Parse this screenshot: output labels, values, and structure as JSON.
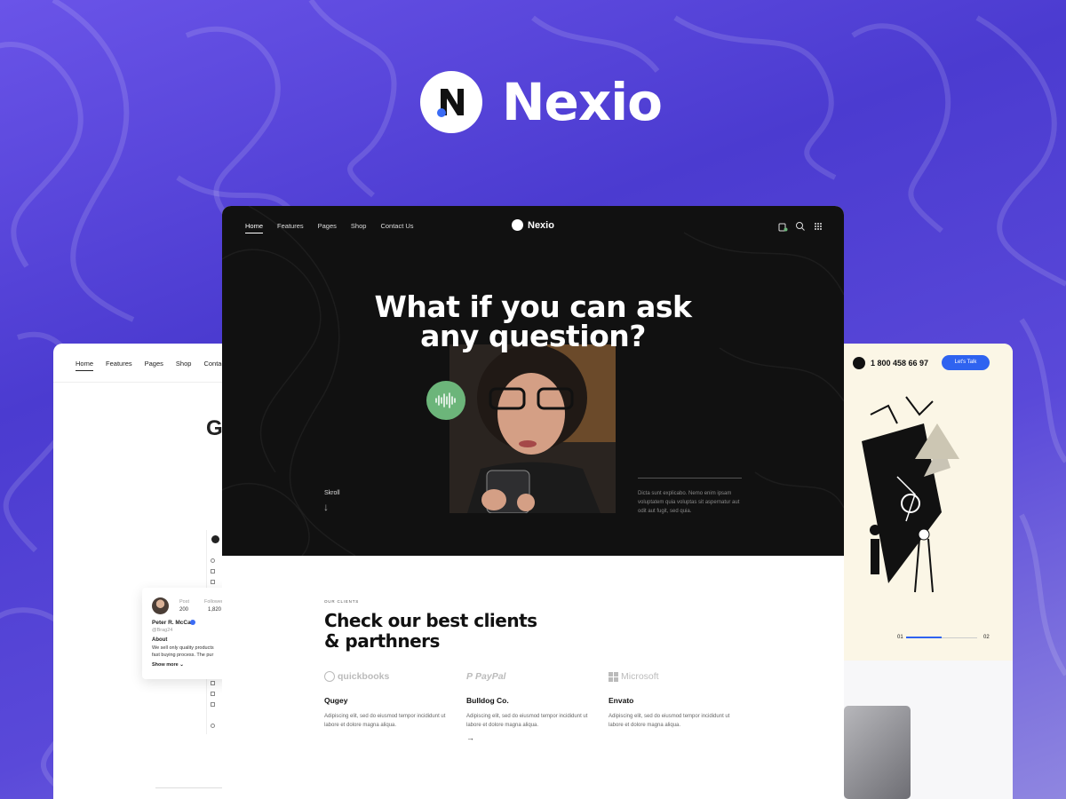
{
  "brand": {
    "name": "Nexio"
  },
  "left_card": {
    "nav": [
      "Home",
      "Features",
      "Pages",
      "Shop",
      "Contac"
    ],
    "heading_fragment": "G",
    "profile": {
      "post_label": "Post",
      "post_value": "200",
      "followers_label": "Follower",
      "followers_value": "1,820",
      "name": "Peter R. McCall",
      "handle": "@Brag24",
      "about_label": "About",
      "about_text_1": "We sell only quality products",
      "about_text_2": "fast buying process. The pur",
      "show_more": "Show more"
    }
  },
  "main": {
    "nav": [
      "Home",
      "Features",
      "Pages",
      "Shop",
      "Contact Us"
    ],
    "brand": "Nexio",
    "hero_title_1": "What if you can ask",
    "hero_title_2": "any question?",
    "scroll_label": "Skroll",
    "scroll_arrow": "↓",
    "hero_description": "Dicta sunt explicabo. Nemo enim ipsam voluptatem quia voluptas sit aspernatur aut odit aut fugit, sed quia.",
    "clients_sub": "OUR CLIENTS",
    "clients_title_1": "Check our best clients",
    "clients_title_2": "& parthners",
    "clients": [
      {
        "logo": "quickbooks",
        "name": "Qugey",
        "desc": "Adipiscing elit, sed do eiusmod tempor incididunt ut labore et dolore magna aliqua."
      },
      {
        "logo": "PayPal",
        "name": "Bulldog Co.",
        "desc": "Adipiscing elit, sed do eiusmod tempor incididunt ut labore et dolore magna aliqua.",
        "arrow": "→"
      },
      {
        "logo": "Microsoft",
        "name": "Envato",
        "desc": "Adipiscing elit, sed do eiusmod tempor incididunt ut labore et dolore magna aliqua."
      }
    ]
  },
  "right_card": {
    "phone": "1 800 458 66 97",
    "cta": "Let's Talk",
    "page_start": "01",
    "page_end": "02",
    "progress": 0.5
  },
  "colors": {
    "background": "#5a49d9",
    "hero": "#111111",
    "accent_blue": "#2f63f0",
    "voice_green": "#6cb57a",
    "cream": "#fbf6e6"
  },
  "icons": [
    "nexio-logo-icon",
    "cart-icon",
    "search-icon",
    "grid-menu-icon",
    "voice-wave-icon",
    "phone-icon",
    "verified-icon",
    "chevron-down-icon",
    "microsoft-logo-icon",
    "paypal-logo-icon",
    "quickbooks-logo-icon"
  ]
}
